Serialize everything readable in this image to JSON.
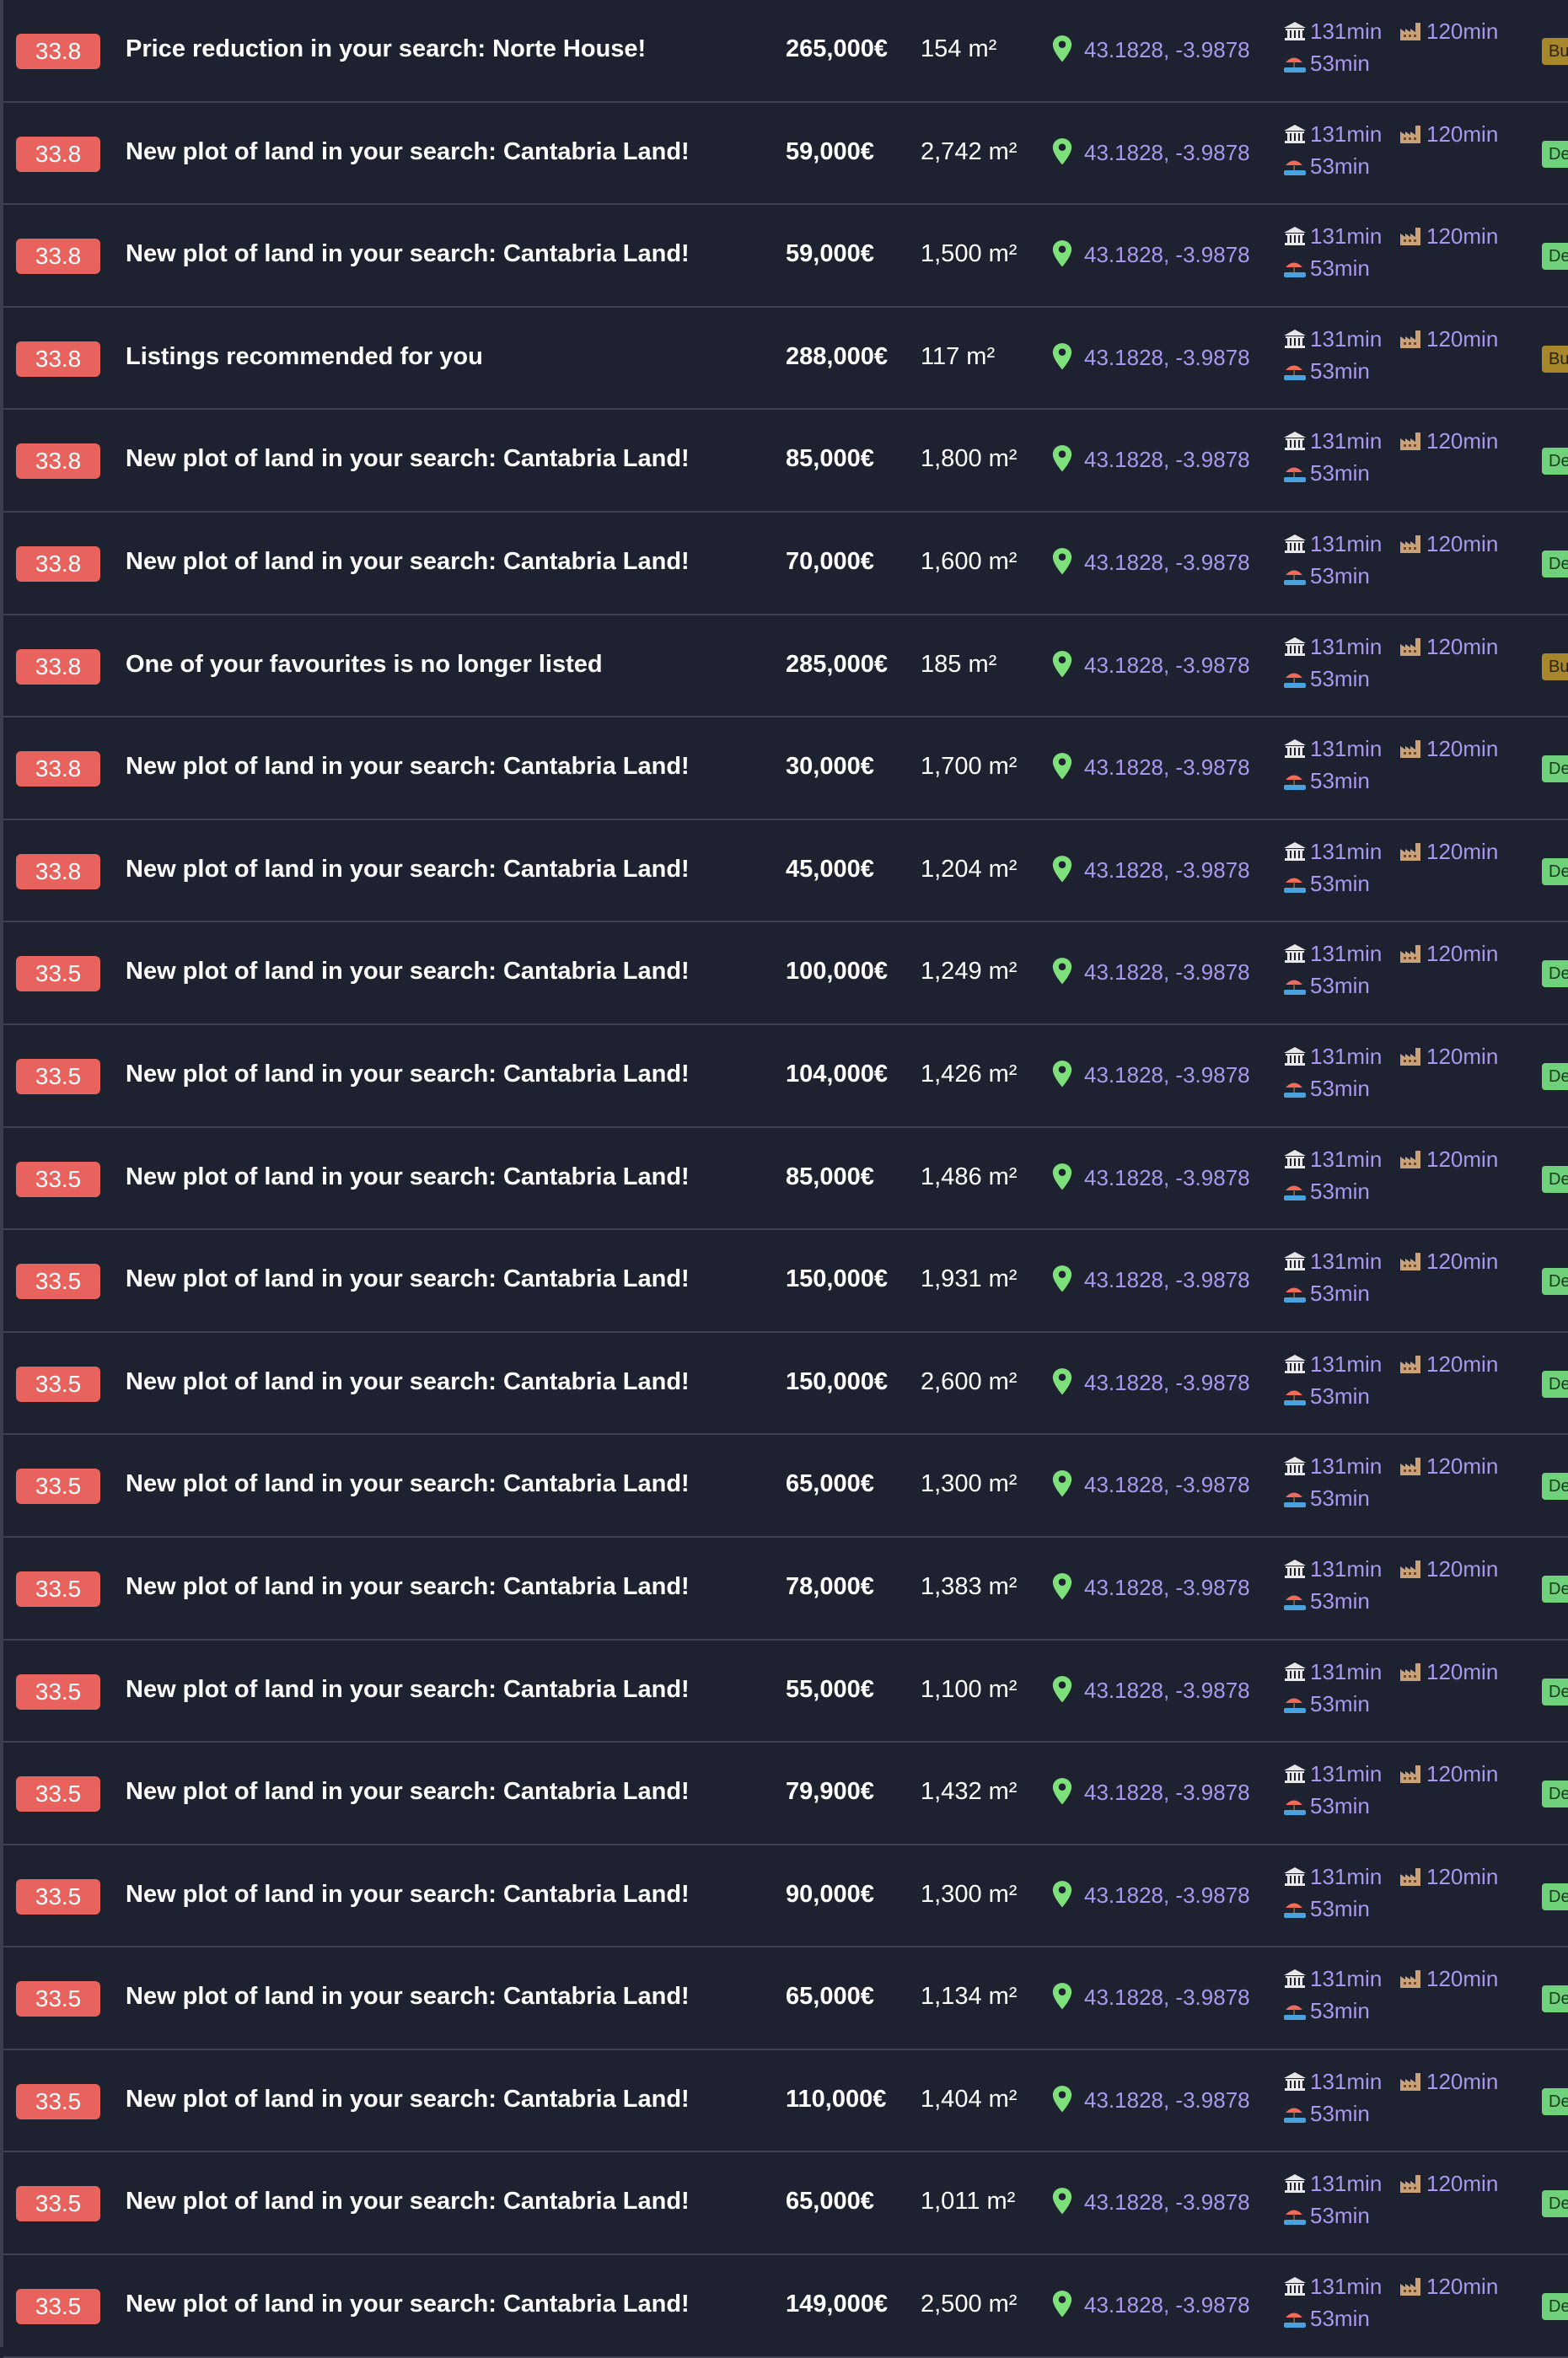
{
  "colors": {
    "background": "#1e2230",
    "score_badge": "#e8625e",
    "accent_text": "#a898ee",
    "pin": "#7ee07a",
    "tag_bu": "#a8862a",
    "tag_de": "#6fd27a"
  },
  "listings": [
    {
      "score": "33.8",
      "title": "Price reduction in your search: Norte House!",
      "price": "265,000€",
      "area": "154 m²",
      "coords": "43.1828, -3.9878",
      "time1": "131min",
      "time2": "120min",
      "time3": "53min",
      "tag": "Bu",
      "tag_type": "bu"
    },
    {
      "score": "33.8",
      "title": "New plot of land in your search: Cantabria Land!",
      "price": "59,000€",
      "area": "2,742 m²",
      "coords": "43.1828, -3.9878",
      "time1": "131min",
      "time2": "120min",
      "time3": "53min",
      "tag": "De",
      "tag_type": "de"
    },
    {
      "score": "33.8",
      "title": "New plot of land in your search: Cantabria Land!",
      "price": "59,000€",
      "area": "1,500 m²",
      "coords": "43.1828, -3.9878",
      "time1": "131min",
      "time2": "120min",
      "time3": "53min",
      "tag": "De",
      "tag_type": "de"
    },
    {
      "score": "33.8",
      "title": "Listings recommended for you",
      "price": "288,000€",
      "area": "117 m²",
      "coords": "43.1828, -3.9878",
      "time1": "131min",
      "time2": "120min",
      "time3": "53min",
      "tag": "Bu",
      "tag_type": "bu"
    },
    {
      "score": "33.8",
      "title": "New plot of land in your search: Cantabria Land!",
      "price": "85,000€",
      "area": "1,800 m²",
      "coords": "43.1828, -3.9878",
      "time1": "131min",
      "time2": "120min",
      "time3": "53min",
      "tag": "De",
      "tag_type": "de"
    },
    {
      "score": "33.8",
      "title": "New plot of land in your search: Cantabria Land!",
      "price": "70,000€",
      "area": "1,600 m²",
      "coords": "43.1828, -3.9878",
      "time1": "131min",
      "time2": "120min",
      "time3": "53min",
      "tag": "De",
      "tag_type": "de"
    },
    {
      "score": "33.8",
      "title": "One of your favourites is no longer listed",
      "price": "285,000€",
      "area": "185 m²",
      "coords": "43.1828, -3.9878",
      "time1": "131min",
      "time2": "120min",
      "time3": "53min",
      "tag": "Bu",
      "tag_type": "bu"
    },
    {
      "score": "33.8",
      "title": "New plot of land in your search: Cantabria Land!",
      "price": "30,000€",
      "area": "1,700 m²",
      "coords": "43.1828, -3.9878",
      "time1": "131min",
      "time2": "120min",
      "time3": "53min",
      "tag": "De",
      "tag_type": "de"
    },
    {
      "score": "33.8",
      "title": "New plot of land in your search: Cantabria Land!",
      "price": "45,000€",
      "area": "1,204 m²",
      "coords": "43.1828, -3.9878",
      "time1": "131min",
      "time2": "120min",
      "time3": "53min",
      "tag": "De",
      "tag_type": "de"
    },
    {
      "score": "33.5",
      "title": "New plot of land in your search: Cantabria Land!",
      "price": "100,000€",
      "area": "1,249 m²",
      "coords": "43.1828, -3.9878",
      "time1": "131min",
      "time2": "120min",
      "time3": "53min",
      "tag": "De",
      "tag_type": "de"
    },
    {
      "score": "33.5",
      "title": "New plot of land in your search: Cantabria Land!",
      "price": "104,000€",
      "area": "1,426 m²",
      "coords": "43.1828, -3.9878",
      "time1": "131min",
      "time2": "120min",
      "time3": "53min",
      "tag": "De",
      "tag_type": "de"
    },
    {
      "score": "33.5",
      "title": "New plot of land in your search: Cantabria Land!",
      "price": "85,000€",
      "area": "1,486 m²",
      "coords": "43.1828, -3.9878",
      "time1": "131min",
      "time2": "120min",
      "time3": "53min",
      "tag": "De",
      "tag_type": "de"
    },
    {
      "score": "33.5",
      "title": "New plot of land in your search: Cantabria Land!",
      "price": "150,000€",
      "area": "1,931 m²",
      "coords": "43.1828, -3.9878",
      "time1": "131min",
      "time2": "120min",
      "time3": "53min",
      "tag": "De",
      "tag_type": "de"
    },
    {
      "score": "33.5",
      "title": "New plot of land in your search: Cantabria Land!",
      "price": "150,000€",
      "area": "2,600 m²",
      "coords": "43.1828, -3.9878",
      "time1": "131min",
      "time2": "120min",
      "time3": "53min",
      "tag": "De",
      "tag_type": "de"
    },
    {
      "score": "33.5",
      "title": "New plot of land in your search: Cantabria Land!",
      "price": "65,000€",
      "area": "1,300 m²",
      "coords": "43.1828, -3.9878",
      "time1": "131min",
      "time2": "120min",
      "time3": "53min",
      "tag": "De",
      "tag_type": "de"
    },
    {
      "score": "33.5",
      "title": "New plot of land in your search: Cantabria Land!",
      "price": "78,000€",
      "area": "1,383 m²",
      "coords": "43.1828, -3.9878",
      "time1": "131min",
      "time2": "120min",
      "time3": "53min",
      "tag": "De",
      "tag_type": "de"
    },
    {
      "score": "33.5",
      "title": "New plot of land in your search: Cantabria Land!",
      "price": "55,000€",
      "area": "1,100 m²",
      "coords": "43.1828, -3.9878",
      "time1": "131min",
      "time2": "120min",
      "time3": "53min",
      "tag": "De",
      "tag_type": "de"
    },
    {
      "score": "33.5",
      "title": "New plot of land in your search: Cantabria Land!",
      "price": "79,900€",
      "area": "1,432 m²",
      "coords": "43.1828, -3.9878",
      "time1": "131min",
      "time2": "120min",
      "time3": "53min",
      "tag": "De",
      "tag_type": "de"
    },
    {
      "score": "33.5",
      "title": "New plot of land in your search: Cantabria Land!",
      "price": "90,000€",
      "area": "1,300 m²",
      "coords": "43.1828, -3.9878",
      "time1": "131min",
      "time2": "120min",
      "time3": "53min",
      "tag": "De",
      "tag_type": "de"
    },
    {
      "score": "33.5",
      "title": "New plot of land in your search: Cantabria Land!",
      "price": "65,000€",
      "area": "1,134 m²",
      "coords": "43.1828, -3.9878",
      "time1": "131min",
      "time2": "120min",
      "time3": "53min",
      "tag": "De",
      "tag_type": "de"
    },
    {
      "score": "33.5",
      "title": "New plot of land in your search: Cantabria Land!",
      "price": "110,000€",
      "area": "1,404 m²",
      "coords": "43.1828, -3.9878",
      "time1": "131min",
      "time2": "120min",
      "time3": "53min",
      "tag": "De",
      "tag_type": "de"
    },
    {
      "score": "33.5",
      "title": "New plot of land in your search: Cantabria Land!",
      "price": "65,000€",
      "area": "1,011 m²",
      "coords": "43.1828, -3.9878",
      "time1": "131min",
      "time2": "120min",
      "time3": "53min",
      "tag": "De",
      "tag_type": "de"
    },
    {
      "score": "33.5",
      "title": "New plot of land in your search: Cantabria Land!",
      "price": "149,000€",
      "area": "2,500 m²",
      "coords": "43.1828, -3.9878",
      "time1": "131min",
      "time2": "120min",
      "time3": "53min",
      "tag": "De",
      "tag_type": "de"
    }
  ]
}
